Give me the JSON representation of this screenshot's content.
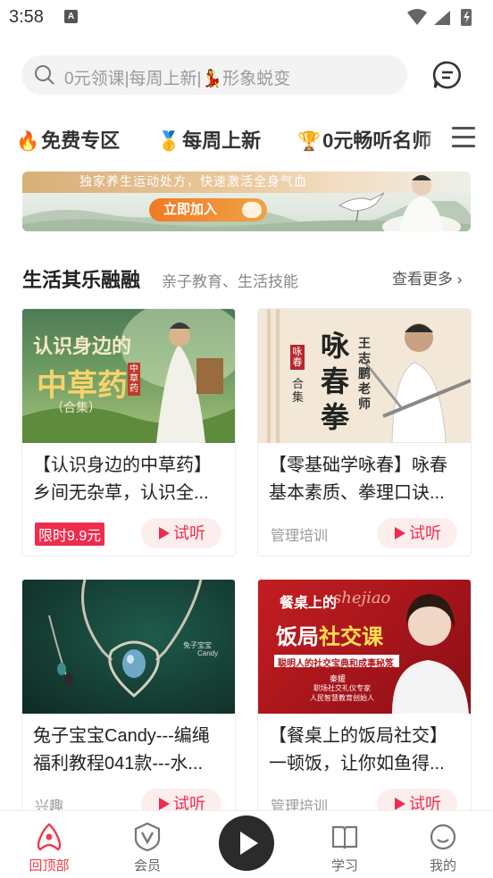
{
  "status_bar": {
    "time": "3:58"
  },
  "search": {
    "placeholder": "0元领课|每周上新|💃形象蜕变"
  },
  "tabs": [
    {
      "emoji": "🔥",
      "label": "免费专区"
    },
    {
      "emoji": "🥇",
      "label": "每周上新"
    },
    {
      "emoji": "🏆",
      "label": "0元畅听名师"
    }
  ],
  "banner": {
    "text": "独家养生运动处方，快速激活全身气血",
    "button": "立即加入"
  },
  "section": {
    "title": "生活其乐融融",
    "subtitle": "亲子教育、生活技能",
    "more": "查看更多"
  },
  "cards": [
    {
      "title_line1": "【认识身边的中草药】",
      "title_line2": "乡间无杂草，认识全...",
      "tag": "限时9.9元",
      "listen": "试听",
      "thumb_text1": "认识身边的",
      "thumb_text2": "中草药",
      "thumb_text3": "（合集）",
      "thumb_seal": "中草药"
    },
    {
      "title_line1": "【零基础学咏春】咏春",
      "title_line2": "基本素质、拳理口诀...",
      "tag": "管理培训",
      "listen": "试听",
      "thumb_text1": "咏",
      "thumb_text2": "春",
      "thumb_text3": "拳",
      "thumb_side": "王志鹏老师",
      "thumb_side2": "合集",
      "thumb_seal": "咏春"
    },
    {
      "title_line1": "兔子宝宝Candy---编绳",
      "title_line2": "福利教程041款---水...",
      "tag": "兴趣",
      "listen": "试听",
      "thumb_text1": "兔子宝宝",
      "thumb_text2": "Candy"
    },
    {
      "title_line1": "【餐桌上的饭局社交】",
      "title_line2": "一顿饭，让你如鱼得...",
      "tag": "管理培训",
      "listen": "试听",
      "thumb_text1": "餐桌上的",
      "thumb_text2": "饭局",
      "thumb_text3": "社交课",
      "thumb_script": "shejiao",
      "thumb_banner": "聪明人的社交宝典和成事秘笈",
      "thumb_name": "秦媛",
      "thumb_role1": "职场社交礼仪专家",
      "thumb_role2": "人民智慧教育创始人"
    }
  ],
  "bottom_nav": [
    {
      "label": "回顶部",
      "active": true
    },
    {
      "label": "会员",
      "active": false
    },
    {
      "label": "学习",
      "active": false
    },
    {
      "label": "我的",
      "active": false
    }
  ],
  "colors": {
    "accent": "#ee2c4e",
    "banner_button": "#f07a24"
  }
}
